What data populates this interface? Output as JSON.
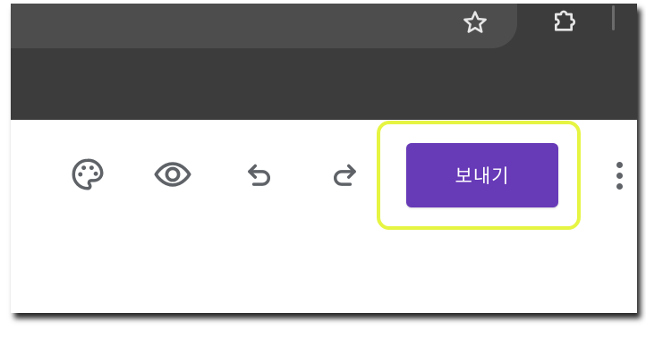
{
  "browser": {
    "bookmark_icon": "star-outline-icon",
    "extensions_icon": "puzzle-piece-icon"
  },
  "toolbar": {
    "customize_theme_icon": "palette-icon",
    "preview_icon": "eye-icon",
    "undo_icon": "undo-icon",
    "redo_icon": "redo-icon",
    "send_label": "보내기",
    "more_icon": "more-vertical-icon"
  },
  "colors": {
    "chrome_dark": "#3c3c3c",
    "omnibox": "#4d4d4d",
    "send_button": "#673ab7",
    "highlight": "#e6f542",
    "icon_gray": "#5f6368"
  }
}
